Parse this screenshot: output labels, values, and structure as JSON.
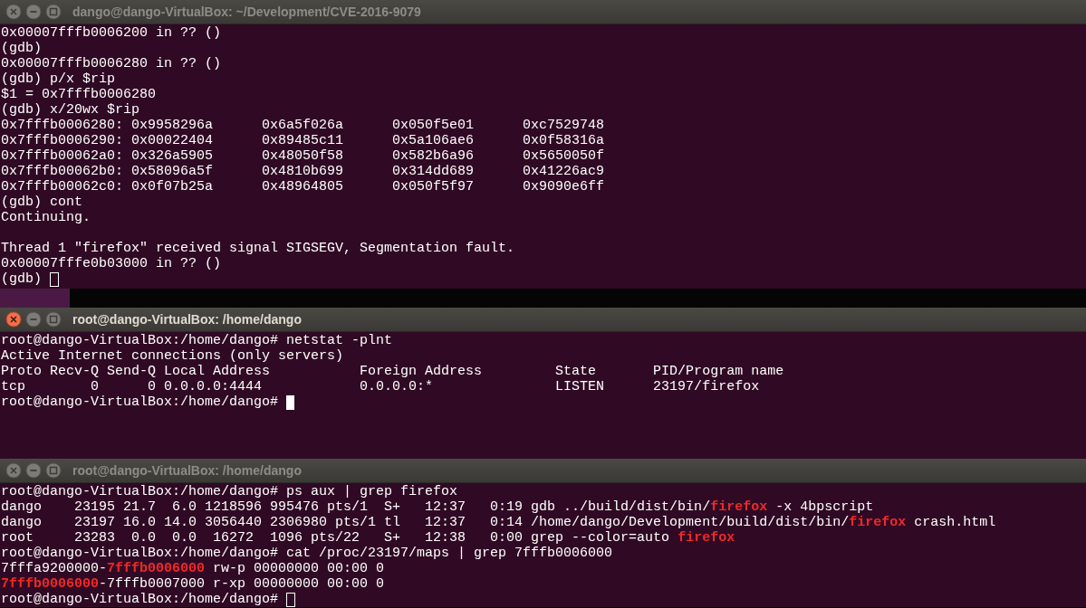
{
  "windows": [
    {
      "title": "dango@dango-VirtualBox: ~/Development/CVE-2016-9079",
      "active": false,
      "cursor": {
        "focused": false
      },
      "lines": [
        "0x00007fffb0006200 in ?? ()",
        "(gdb)",
        "0x00007fffb0006280 in ?? ()",
        "(gdb) p/x $rip",
        "$1 = 0x7fffb0006280",
        "(gdb) x/20wx $rip",
        "0x7fffb0006280: 0x9958296a      0x6a5f026a      0x050f5e01      0xc7529748",
        "0x7fffb0006290: 0x00022404      0x89485c11      0x5a106ae6      0x0f58316a",
        "0x7fffb00062a0: 0x326a5905      0x48050f58      0x582b6a96      0x5650050f",
        "0x7fffb00062b0: 0x58096a5f      0x4810b699      0x314dd689      0x41226ac9",
        "0x7fffb00062c0: 0x0f07b25a      0x48964805      0x050f5f97      0x9090e6ff",
        "(gdb) cont",
        "Continuing.",
        {
          "kind": "blank"
        },
        "Thread 1 \"firefox\" received signal SIGSEGV, Segmentation fault.",
        "0x00007fffe0b03000 in ?? ()",
        "(gdb) "
      ]
    },
    {
      "title": "root@dango-VirtualBox: /home/dango",
      "active": true,
      "cursor": {
        "focused": true
      },
      "lines": [
        "root@dango-VirtualBox:/home/dango# netstat -plnt",
        "Active Internet connections (only servers)",
        "Proto Recv-Q Send-Q Local Address           Foreign Address         State       PID/Program name",
        "tcp        0      0 0.0.0.0:4444            0.0.0.0:*               LISTEN      23197/firefox",
        "root@dango-VirtualBox:/home/dango# "
      ]
    },
    {
      "title": "root@dango-VirtualBox: /home/dango",
      "active": false,
      "cursor": {
        "focused": false
      },
      "lines": [
        "root@dango-VirtualBox:/home/dango# ps aux | grep firefox",
        {
          "parts": [
            {
              "text": "dango    23195 21.7  6.0 1218596 995476 pts/1  S+   12:37   0:19 gdb ../build/dist/bin/",
              "match": false
            },
            {
              "text": "firefox",
              "match": true
            },
            {
              "text": " -x 4bpscript",
              "match": false
            }
          ]
        },
        {
          "parts": [
            {
              "text": "dango    23197 16.0 14.0 3056440 2306980 pts/1 tl   12:37   0:14 /home/dango/Development/build/dist/bin/",
              "match": false
            },
            {
              "text": "firefox",
              "match": true
            },
            {
              "text": " crash.html",
              "match": false
            }
          ]
        },
        {
          "parts": [
            {
              "text": "root     23283  0.0  0.0  16272  1096 pts/22   S+   12:38   0:00 grep --color=auto ",
              "match": false
            },
            {
              "text": "firefox",
              "match": true
            }
          ]
        },
        "root@dango-VirtualBox:/home/dango# cat /proc/23197/maps | grep 7fffb0006000",
        {
          "parts": [
            {
              "text": "7fffa9200000-",
              "match": false
            },
            {
              "text": "7fffb0006000",
              "match": true
            },
            {
              "text": " rw-p 00000000 00:00 0",
              "match": false
            }
          ]
        },
        {
          "parts": [
            {
              "text": "7fffb0006000",
              "match": true
            },
            {
              "text": "-7fffb0007000 r-xp 00000000 00:00 0",
              "match": false
            }
          ]
        },
        "root@dango-VirtualBox:/home/dango# "
      ]
    }
  ]
}
